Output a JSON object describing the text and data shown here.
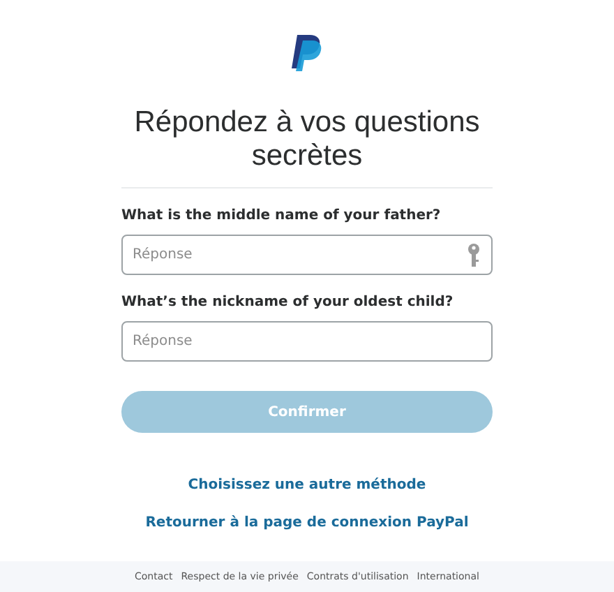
{
  "heading": "Répondez à vos questions secrètes",
  "questions": [
    {
      "label": "What is the middle name of your father?",
      "placeholder": "Réponse",
      "key_icon": true
    },
    {
      "label": "What’s the nickname of your oldest child?",
      "placeholder": "Réponse",
      "key_icon": false
    }
  ],
  "confirm_button": {
    "label": "Confirmer",
    "disabled": true
  },
  "links": [
    "Choisissez une autre méthode",
    "Retourner à la page de connexion PayPal"
  ],
  "footer_links": [
    "Contact",
    "Respect de la vie privée",
    "Contrats d'utilisation",
    "International"
  ]
}
